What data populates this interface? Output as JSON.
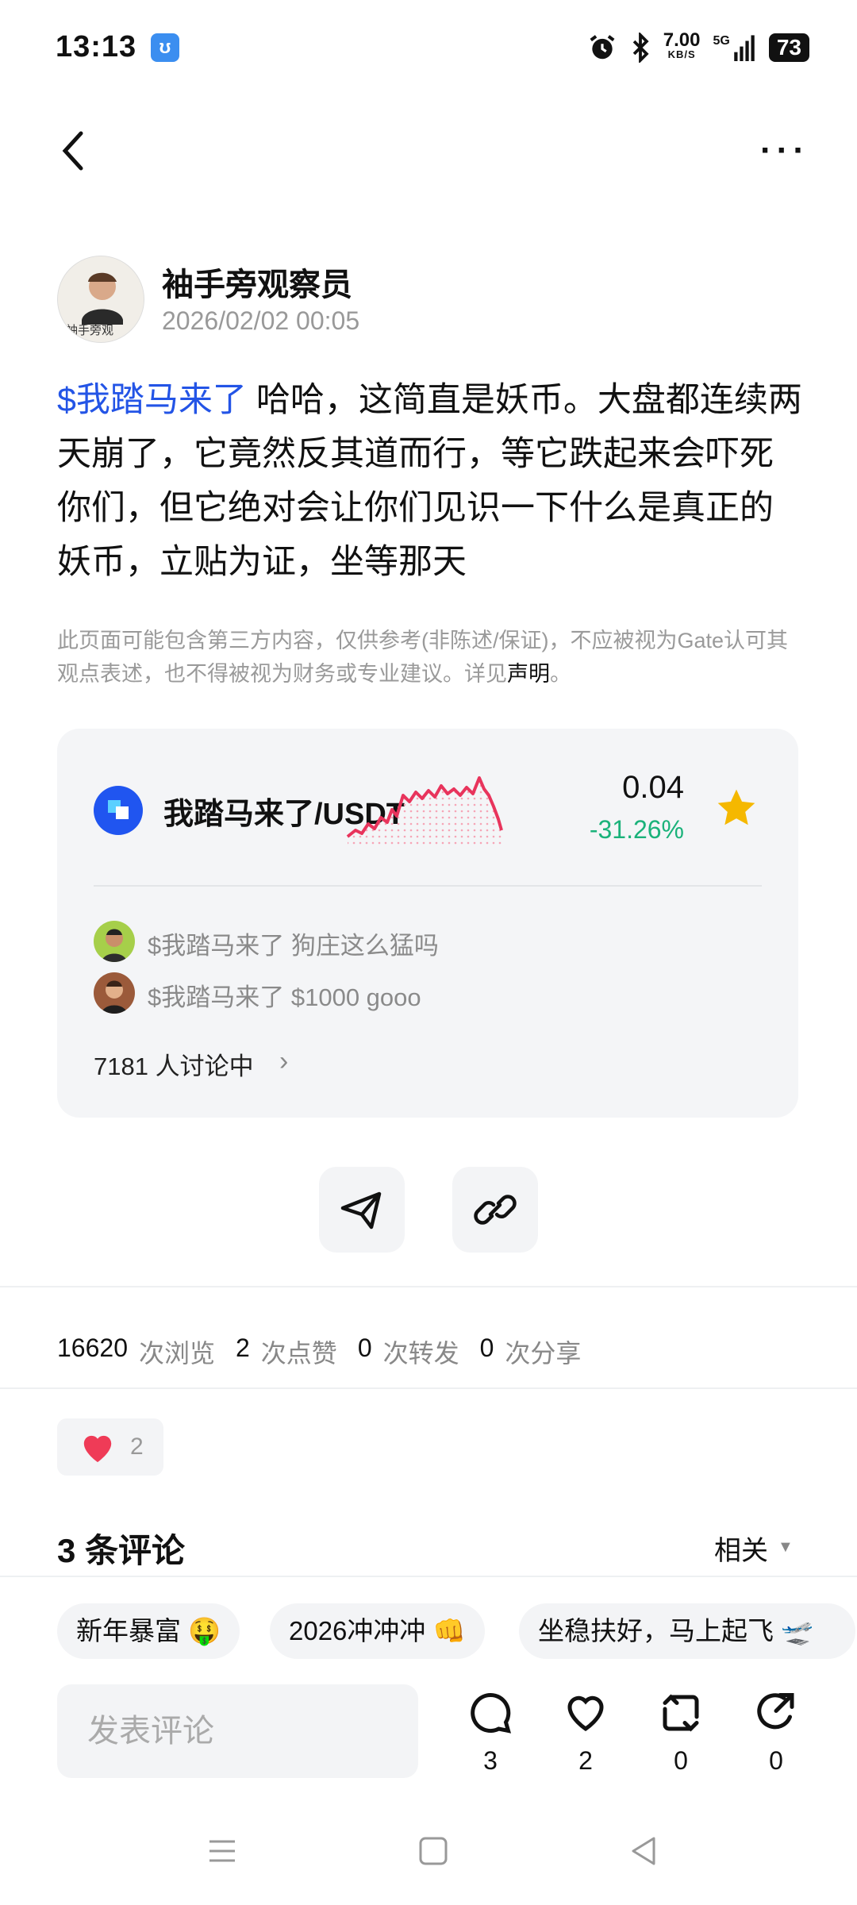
{
  "status_bar": {
    "time": "13:13",
    "speed_value": "7.00",
    "speed_unit": "KB/S",
    "network": "5G",
    "battery": "73"
  },
  "post": {
    "author_name": "袖手旁观察员",
    "avatar_caption": "袖手旁观",
    "timestamp": "2026/02/02 00:05",
    "cashtag": "$我踏马来了",
    "text": " 哈哈，这简直是妖币。大盘都连续两天崩了，它竟然反其道而行，等它跌起来会吓死你们，但它绝对会让你们见识一下什么是真正的妖币，立贴为证，坐等那天",
    "disclaimer_text": "此页面可能包含第三方内容，仅供参考(非陈述/保证)，不应被视为Gate认可其观点表述，也不得被视为财务或专业建议。详见",
    "disclaimer_link": "声明",
    "disclaimer_end": "。"
  },
  "coin_card": {
    "pair": "我踏马来了/USDT",
    "price": "0.04",
    "change": "-31.26%",
    "change_color": "#1ab27a",
    "sparkline_color": "#e8345c",
    "comments": [
      {
        "prefix": "$我踏马来了",
        "text": " 狗庄这么猛吗"
      },
      {
        "prefix": "$我踏马来了",
        "text": " $1000 gooo"
      }
    ],
    "discussing": "7181 人讨论中",
    "chevron": "›",
    "favorite_icon": "star-icon"
  },
  "stats": {
    "views": "16620",
    "views_label": "次浏览",
    "likes": "2",
    "likes_label": "次点赞",
    "reposts": "0",
    "reposts_label": "次转发",
    "shares": "0",
    "shares_label": "次分享"
  },
  "reaction": {
    "count": "2"
  },
  "comments_section": {
    "title": "3 条评论",
    "sort_label": "相关",
    "sort_arrow": "▼"
  },
  "quick_replies": [
    "新年暴富 🤑",
    "2026冲冲冲 👊",
    "坐稳扶好，马上起飞 🛫"
  ],
  "bottom_bar": {
    "comment_placeholder": "发表评论",
    "comment_count": "3",
    "like_count": "2",
    "repost_count": "0",
    "share_count": "0"
  },
  "accent_color": "#2354e6"
}
